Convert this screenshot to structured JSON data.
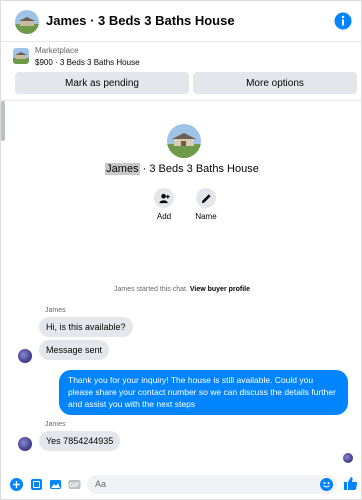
{
  "header": {
    "title": "James · 3 Beds 3 Baths House",
    "info_icon": "info-icon"
  },
  "listing": {
    "source": "Marketplace",
    "price_title": "$900 · 3 Beds 3 Baths House",
    "pending_label": "Mark as pending",
    "more_label": "More options"
  },
  "profile": {
    "name_highlight": "James",
    "name_rest": " · 3 Beds 3 Baths House",
    "actions": [
      {
        "label": "Add",
        "icon": "add-person-icon"
      },
      {
        "label": "Name",
        "icon": "pencil-icon"
      }
    ]
  },
  "chat": {
    "started_text": "James started this chat.",
    "view_profile_link": "View buyer profile",
    "messages": [
      {
        "sender": "James",
        "text": "Hi, is this available?",
        "direction": "in"
      },
      {
        "text": "Message sent",
        "direction": "in"
      },
      {
        "text": "Thank you for your inquiry! The house is still available. Could you please share your contact number so we can discuss the details further and assist you with the next steps",
        "direction": "out"
      },
      {
        "sender": "James",
        "text": "Yes 7854244935",
        "direction": "in"
      }
    ]
  },
  "composer": {
    "placeholder": "Aa",
    "icons": [
      "plus-icon",
      "sticker-icon",
      "photo-icon",
      "gif-icon",
      "emoji-icon",
      "thumbs-up-icon"
    ]
  },
  "colors": {
    "accent": "#0084ff",
    "bubble_in": "#e4e6eb",
    "muted_text": "#65676b"
  }
}
